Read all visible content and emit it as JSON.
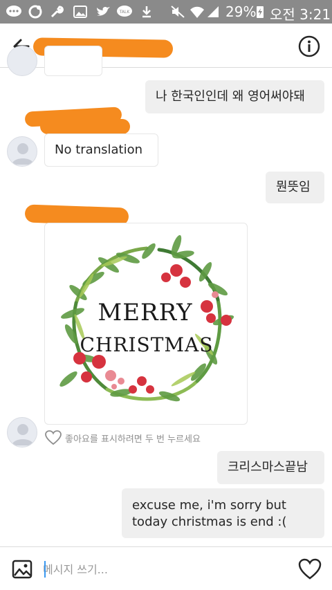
{
  "status_bar": {
    "battery": "29%",
    "time": "오전 3:21"
  },
  "header": {
    "back_icon": "arrow-left-icon",
    "info_icon": "info-circle-icon"
  },
  "messages": [
    {
      "sender": "me",
      "text": "나 한국인인데 왜 영어써야돼"
    },
    {
      "sender": "them",
      "text": "No translation"
    },
    {
      "sender": "me",
      "text": "뭔뜻임"
    },
    {
      "sender": "them",
      "type": "image",
      "image_text": "MERRY CHRISTMAS"
    },
    {
      "sender": "me",
      "text": "크리스마스끝남"
    },
    {
      "sender": "me",
      "text_lines": [
        "excuse me, i'm sorry but",
        "today christmas is end :("
      ]
    }
  ],
  "like_hint": "좋아요를 표시하려면 두 번 누르세요",
  "compose": {
    "placeholder": "메시지 쓰기...",
    "image_icon": "gallery-icon",
    "like_icon": "heart-icon"
  },
  "colors": {
    "status_bar": "#8a8a8a",
    "redaction": "#f58b1f",
    "my_bubble": "#efefef",
    "caret": "#3897f0"
  }
}
